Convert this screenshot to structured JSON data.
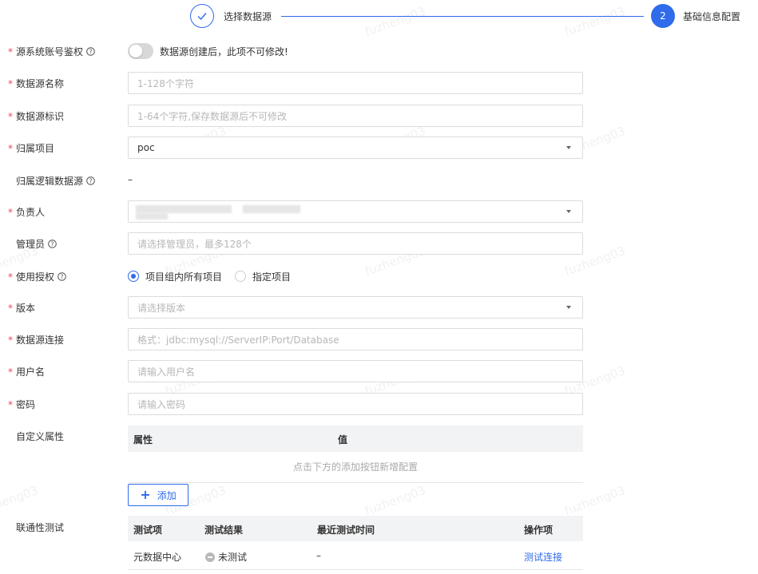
{
  "steps": [
    {
      "label": "选择数据源",
      "status": "done"
    },
    {
      "number": "2",
      "label": "基础信息配置",
      "status": "active"
    }
  ],
  "form": {
    "auth": {
      "label": "源系统账号鉴权",
      "required": true,
      "toggle_on": false,
      "note": "数据源创建后，此项不可修改!"
    },
    "name": {
      "label": "数据源名称",
      "required": true,
      "placeholder": "1-128个字符"
    },
    "identifier": {
      "label": "数据源标识",
      "required": true,
      "placeholder": "1-64个字符,保存数据源后不可修改"
    },
    "project": {
      "label": "归属项目",
      "required": true,
      "value": "poc"
    },
    "logic_ds": {
      "label": "归属逻辑数据源",
      "required": false,
      "value": "–"
    },
    "owner": {
      "label": "负责人",
      "required": true
    },
    "admin": {
      "label": "管理员",
      "required": false,
      "placeholder": "请选择管理员，最多128个"
    },
    "usage": {
      "label": "使用授权",
      "required": true,
      "options": [
        "项目组内所有项目",
        "指定项目"
      ],
      "selected": "项目组内所有项目"
    },
    "version": {
      "label": "版本",
      "required": true,
      "placeholder": "请选择版本"
    },
    "connection": {
      "label": "数据源连接",
      "required": true,
      "placeholder": "格式：jdbc:mysql://ServerIP:Port/Database"
    },
    "username": {
      "label": "用户名",
      "required": true,
      "placeholder": "请输入用户名"
    },
    "password": {
      "label": "密码",
      "required": true,
      "placeholder": "请输入密码"
    },
    "custom_props": {
      "label": "自定义属性",
      "columns": [
        "属性",
        "值"
      ],
      "empty_text": "点击下方的添加按钮新增配置",
      "add_label": "添加"
    },
    "conn_test": {
      "label": "联通性测试",
      "columns": [
        "测试项",
        "测试结果",
        "最近测试时间",
        "操作项"
      ],
      "rows": [
        {
          "item": "元数据中心",
          "result": "未测试",
          "time": "–",
          "action": "测试连接"
        }
      ]
    }
  },
  "watermark": "fuzheng03",
  "colors": {
    "primary": "#2f6bea",
    "required": "#e34d59"
  }
}
